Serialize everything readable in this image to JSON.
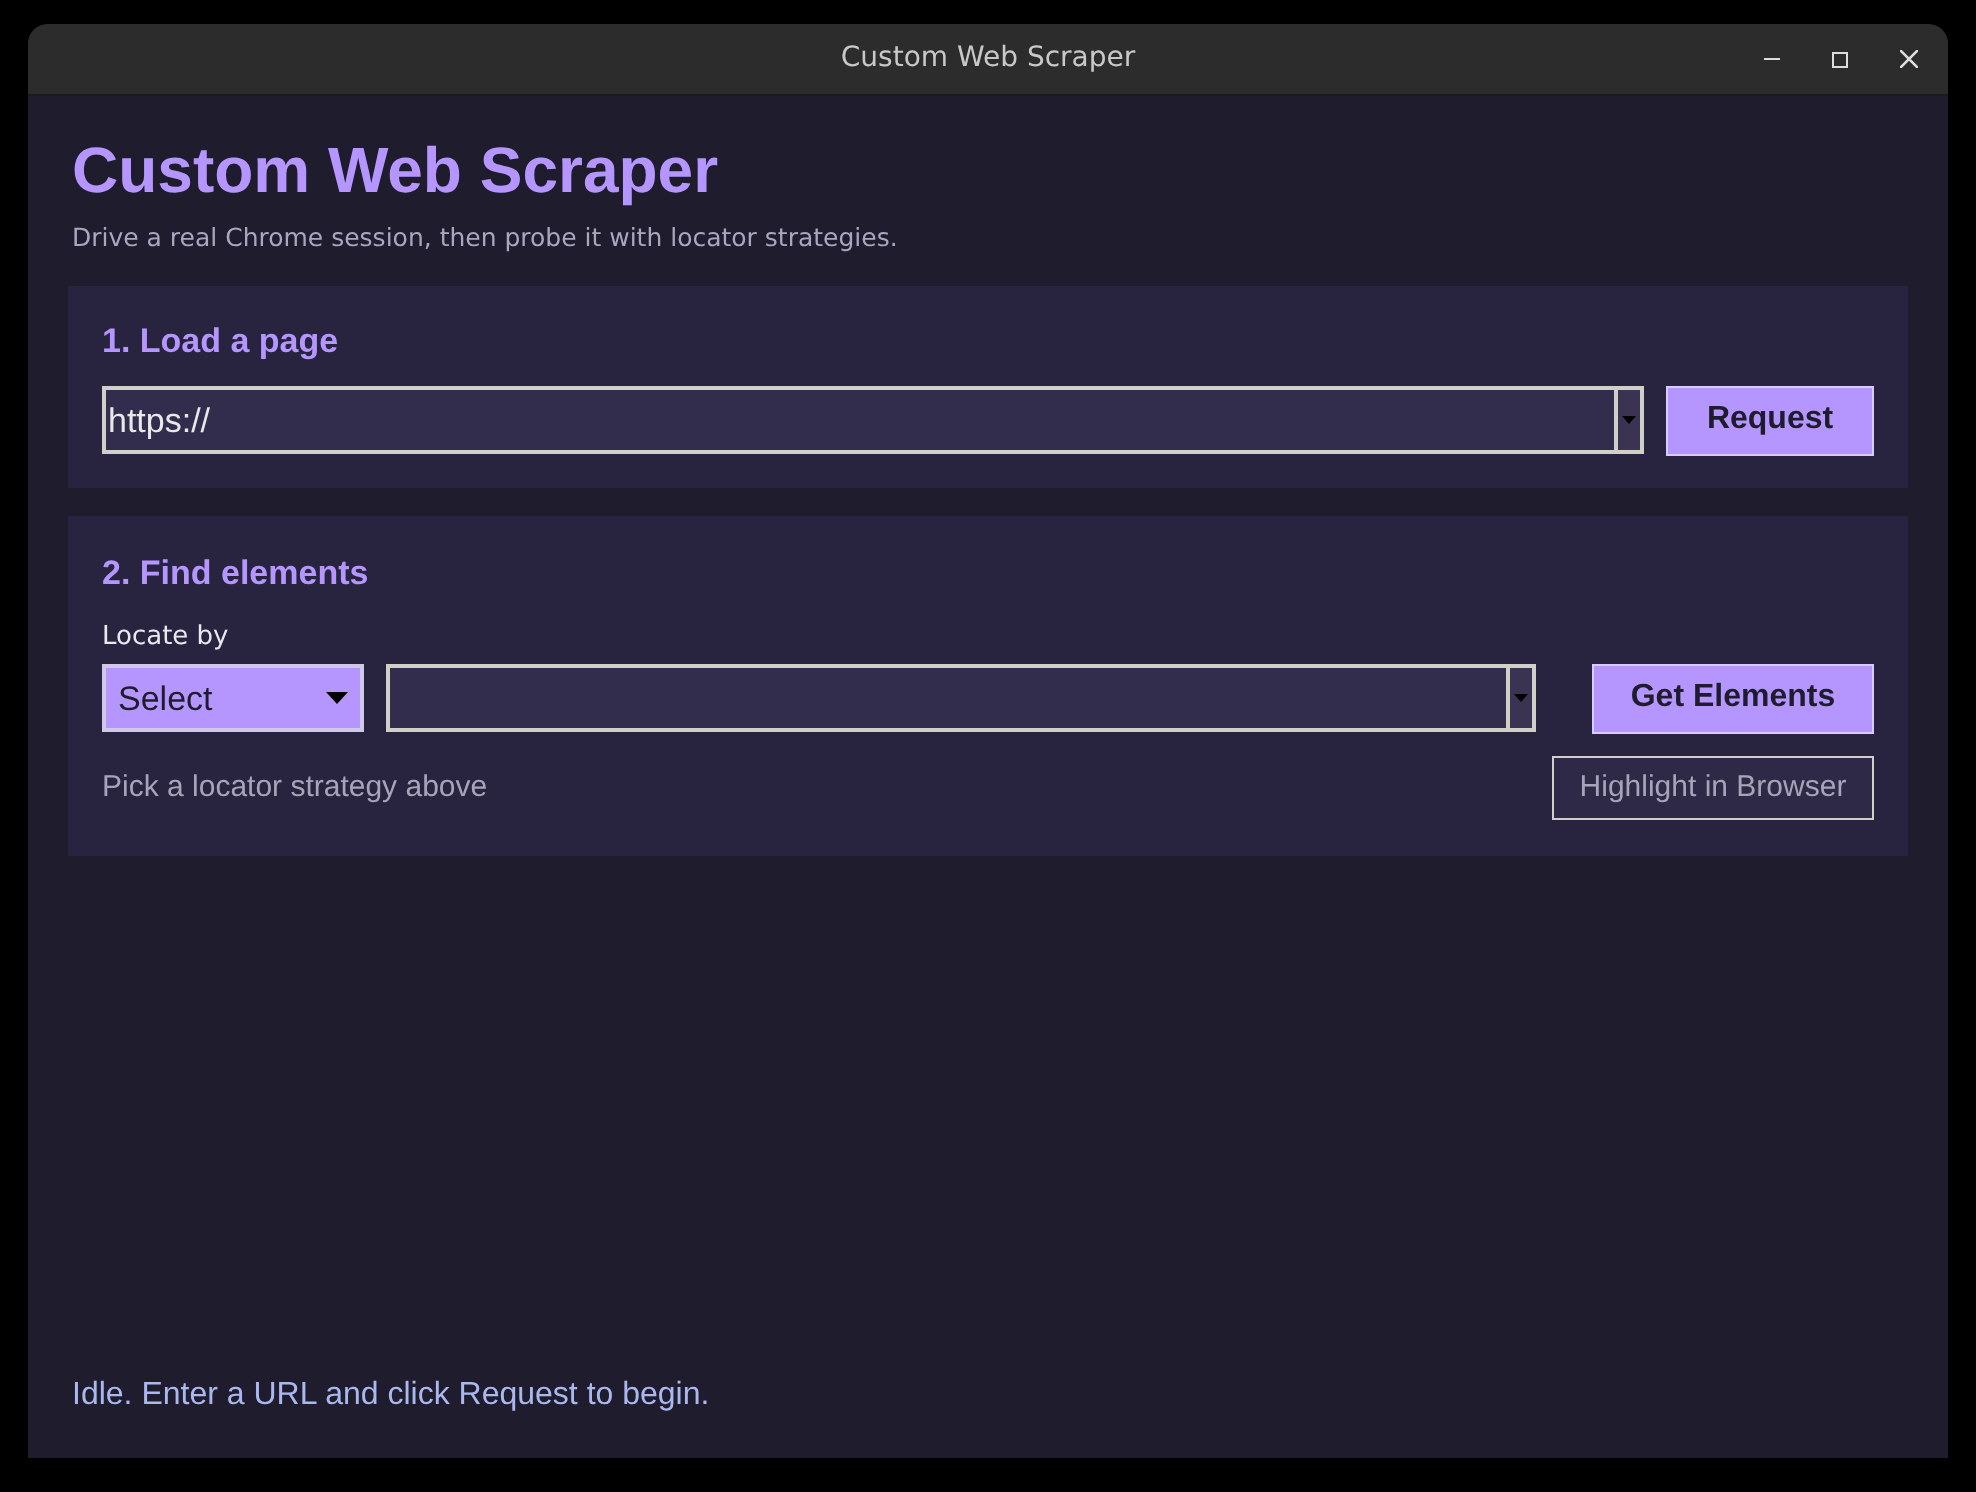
{
  "window": {
    "title": "Custom Web Scraper"
  },
  "header": {
    "title": "Custom Web Scraper",
    "subtitle": "Drive a real Chrome session, then probe it with locator strategies."
  },
  "load_panel": {
    "heading": "1. Load a page",
    "url_field": {
      "value": "https://"
    },
    "button": {
      "label": "Request"
    }
  },
  "find_panel": {
    "heading": "2. Find elements",
    "locate_label": "Locate by",
    "strategy_select": {
      "value": "Select"
    },
    "button": {
      "label": "Get Elements"
    },
    "hint": "Pick a locator strategy above",
    "highlight_button": {
      "label": "Highlight in Browser",
      "disabled": true
    }
  },
  "status_bar": {
    "text": "Idle. Enter a URL and click Request to begin."
  }
}
